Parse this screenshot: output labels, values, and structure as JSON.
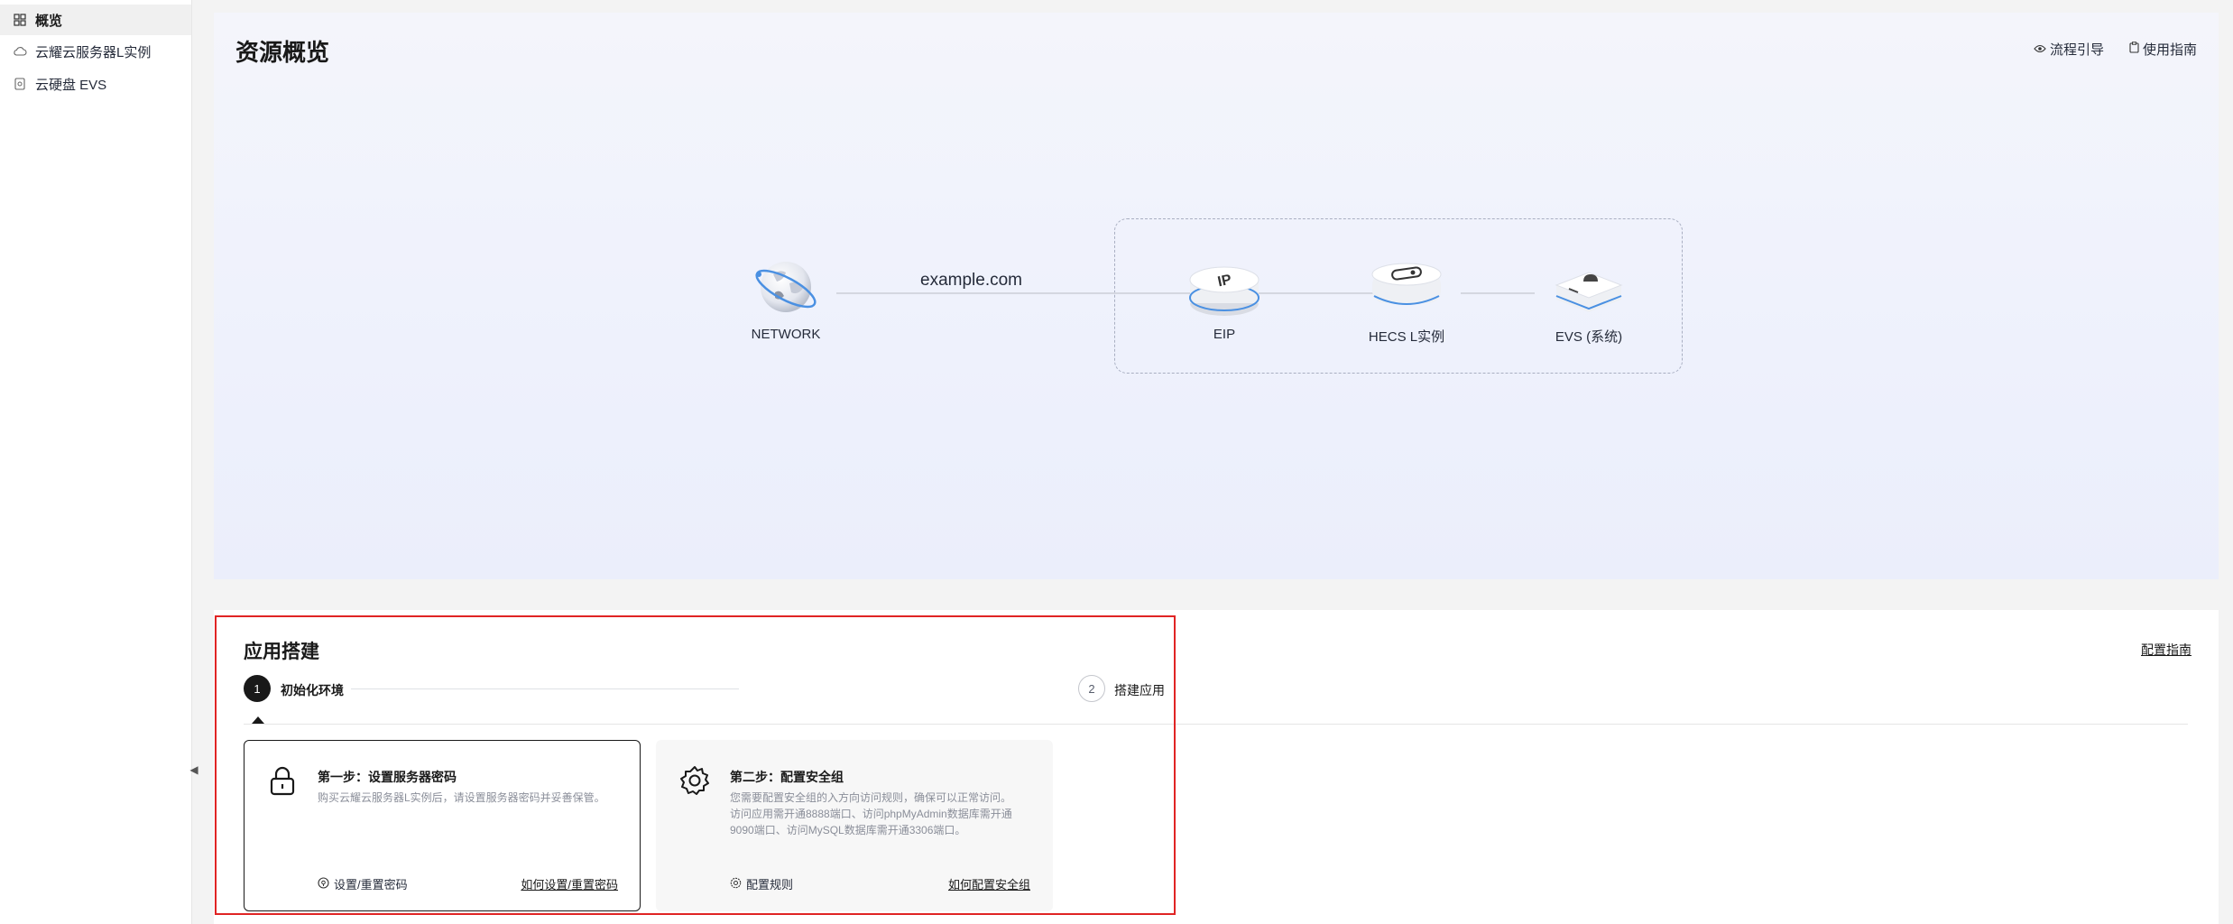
{
  "sidebar": {
    "items": [
      {
        "label": "概览",
        "icon": "grid-icon",
        "active": true
      },
      {
        "label": "云耀云服务器L实例",
        "icon": "cloud-icon",
        "active": false
      },
      {
        "label": "云硬盘 EVS",
        "icon": "disk-icon",
        "active": false
      }
    ]
  },
  "overview": {
    "title": "资源概览",
    "links": {
      "flow_guide": "流程引导",
      "usage_guide": "使用指南"
    },
    "diagram": {
      "network_label": "NETWORK",
      "domain": "example.com",
      "eip_label": "EIP",
      "hecs_label": "HECS L实例",
      "evs_label": "EVS (系统)"
    }
  },
  "build": {
    "title": "应用搭建",
    "guide_link": "配置指南",
    "steps": [
      {
        "number": "1",
        "label": "初始化环境"
      },
      {
        "number": "2",
        "label": "搭建应用"
      }
    ],
    "cards": [
      {
        "title": "第一步：设置服务器密码",
        "desc": [
          "购买云耀云服务器L实例后，请设置服务器密码并妥善保管。"
        ],
        "action": "设置/重置密码",
        "link": "如何设置/重置密码"
      },
      {
        "title": "第二步：配置安全组",
        "desc": [
          "您需要配置安全组的入方向访问规则，确保可以正常访问。",
          "访问应用需开通8888端口、访问phpMyAdmin数据库需开通",
          "9090端口、访问MySQL数据库需开通3306端口。"
        ],
        "action": "配置规则",
        "link": "如何配置安全组"
      }
    ]
  },
  "colors": {
    "highlight": "#e02424",
    "accent_blue": "#4a90e2",
    "dark": "#191919"
  }
}
